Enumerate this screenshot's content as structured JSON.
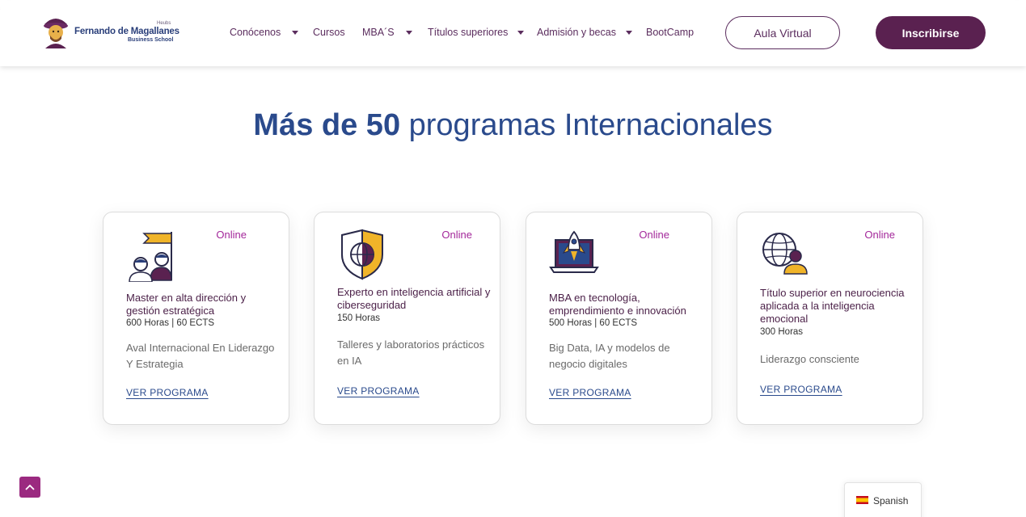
{
  "header": {
    "logo": {
      "top_text": "Heubs",
      "name": "Fernando de Magallanes",
      "sub": "Business School"
    },
    "nav": [
      {
        "label": "Conócenos",
        "has_dropdown": true
      },
      {
        "label": "Cursos",
        "has_dropdown": false
      },
      {
        "label": "MBA´S",
        "has_dropdown": true
      },
      {
        "label": "Títulos superiores",
        "has_dropdown": true
      },
      {
        "label": "Admisión y becas",
        "has_dropdown": true
      },
      {
        "label": "BootCamp",
        "has_dropdown": false
      }
    ],
    "aula_label": "Aula Virtual",
    "inscribirse_label": "Inscribirse"
  },
  "main": {
    "heading_bold": "Más de 50",
    "heading_rest": " programas Internacionales",
    "cards": [
      {
        "icon": "leadership-flag-icon",
        "mode": "Online",
        "title": "Master en alta dirección y gestión estratégica",
        "hours": "600 Horas | 60 ECTS",
        "desc": "Aval Internacional En Liderazgo Y Estrategia",
        "link": "VER PROGRAMA"
      },
      {
        "icon": "shield-globe-icon",
        "mode": "Online",
        "title": "Experto en inteligencia artificial y ciberseguridad",
        "hours": "150 Horas",
        "desc": "Talleres y laboratorios prácticos en IA",
        "link": "VER PROGRAMA"
      },
      {
        "icon": "rocket-laptop-icon",
        "mode": "Online",
        "title": "MBA en tecnología, emprendimiento e innovación",
        "hours": "500 Horas | 60 ECTS",
        "desc": "Big Data, IA y modelos de negocio digitales",
        "link": "VER PROGRAMA"
      },
      {
        "icon": "globe-person-icon",
        "mode": "Online",
        "title": "Título superior en neurociencia aplicada a la inteligencia emocional",
        "hours": "300 Horas",
        "desc": "Liderazgo consciente",
        "link": "VER PROGRAMA"
      }
    ]
  },
  "language": {
    "label": "Spanish",
    "flag": "spain-flag-icon"
  },
  "colors": {
    "primary": "#5a2150",
    "heading": "#2a4a8c",
    "accent": "#a3279a",
    "gold": "#f0b429"
  }
}
